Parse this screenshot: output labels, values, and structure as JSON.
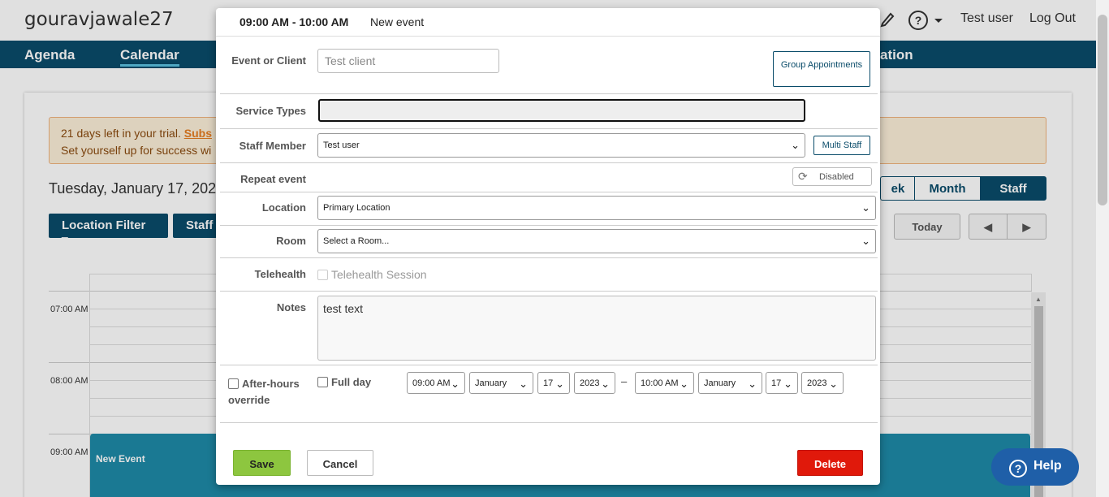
{
  "topbar": {
    "brand": "gouravjawale27",
    "user": "Test user",
    "logout": "Log Out"
  },
  "nav": {
    "agenda": "Agenda",
    "calendar": "Calendar",
    "location_partial": "ation"
  },
  "trial": {
    "line1_prefix": "21 days left in your trial. ",
    "line1_link": "Subs",
    "line2": "Set yourself up for success wi"
  },
  "calendar": {
    "date_title": "Tuesday, January 17, 202",
    "location_filter": "Location Filter ▾",
    "staff_filter": "Staff",
    "views": {
      "week_partial": "ek",
      "month": "Month",
      "staff": "Staff"
    },
    "today": "Today",
    "prev": "◀",
    "next": "▶",
    "times": [
      "07:00 AM",
      "08:00 AM",
      "09:00 AM"
    ],
    "event_title": "New Event"
  },
  "help": {
    "label": "Help",
    "icon": "?"
  },
  "modal": {
    "time_range": "09:00 AM - 10:00 AM",
    "event_name": "New event",
    "client_label": "Event or Client",
    "client_placeholder": "Test client",
    "group_btn": "Group Appointments",
    "service_label": "Service Types",
    "staff_label": "Staff Member",
    "staff_value": "Test user",
    "multi_staff": "Multi Staff",
    "repeat_label": "Repeat event",
    "repeat_value": "Disabled",
    "location_label": "Location",
    "location_value": "Primary Location",
    "room_label": "Room",
    "room_value": "Select a Room...",
    "telehealth_label": "Telehealth",
    "telehealth_option": "Telehealth Session",
    "notes_label": "Notes",
    "notes_value": "test text",
    "afterhours_label": "After-hours",
    "afterhours_label2": "override",
    "fullday_label": "Full day",
    "start_time": "09:00 AM",
    "start_month": "January",
    "start_day": "17",
    "start_year": "2023",
    "dash": "–",
    "end_time": "10:00 AM",
    "end_month": "January",
    "end_day": "17",
    "end_year": "2023",
    "save": "Save",
    "cancel": "Cancel",
    "delete": "Delete"
  },
  "colors": {
    "nav": "#0a4c6a",
    "save": "#8dc63f",
    "delete": "#e0190b",
    "event": "#1e8aa8",
    "help": "#1f5fa8"
  }
}
